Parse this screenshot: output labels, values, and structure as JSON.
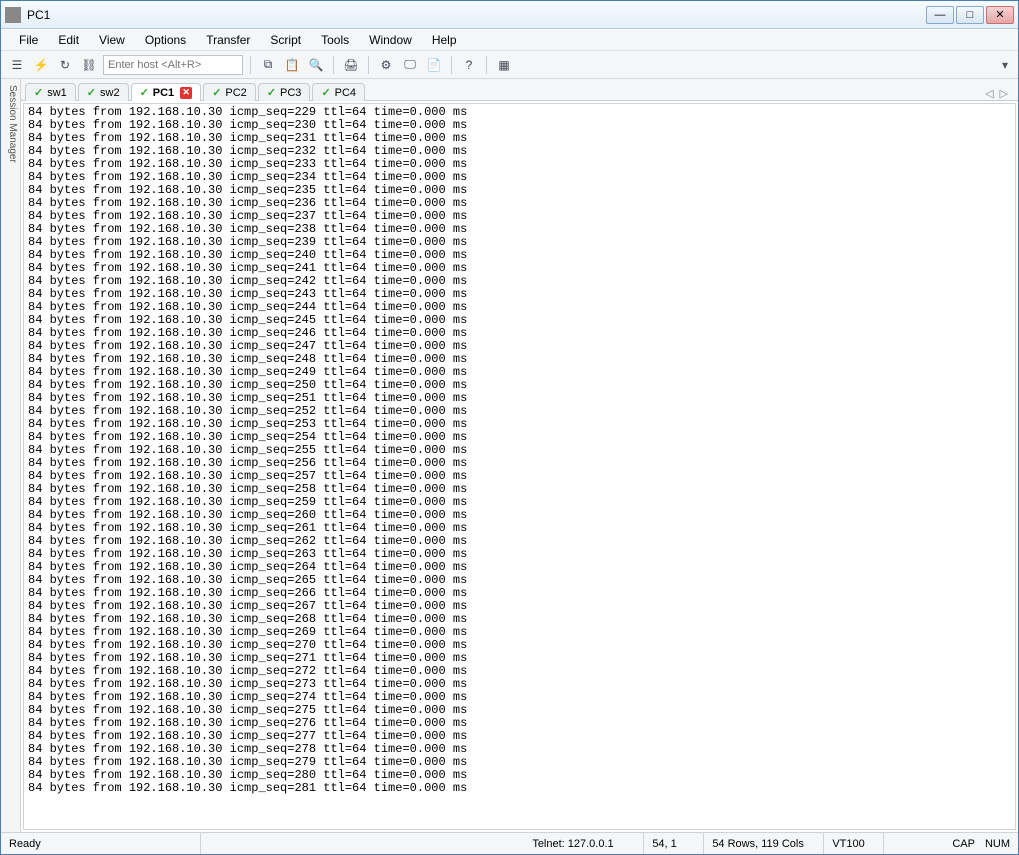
{
  "window": {
    "title": "PC1"
  },
  "menubar": [
    "File",
    "Edit",
    "View",
    "Options",
    "Transfer",
    "Script",
    "Tools",
    "Window",
    "Help"
  ],
  "toolbar": {
    "host_placeholder": "Enter host <Alt+R>"
  },
  "sidebar": {
    "label": "Session Manager"
  },
  "tabs": [
    {
      "label": "sw1",
      "active": false,
      "closable": false
    },
    {
      "label": "sw2",
      "active": false,
      "closable": false
    },
    {
      "label": "PC1",
      "active": true,
      "closable": true
    },
    {
      "label": "PC2",
      "active": false,
      "closable": false
    },
    {
      "label": "PC3",
      "active": false,
      "closable": false
    },
    {
      "label": "PC4",
      "active": false,
      "closable": false
    }
  ],
  "terminal": {
    "bytes": "84",
    "ip": "192.168.10.30",
    "ttl": "64",
    "time": "0.000",
    "seq_start": 229,
    "seq_end": 281
  },
  "status": {
    "ready": "Ready",
    "connection": "Telnet: 127.0.0.1",
    "cursor": "54,  1",
    "dimensions": "54 Rows, 119 Cols",
    "term_type": "VT100",
    "caps": "CAP",
    "num": "NUM"
  }
}
